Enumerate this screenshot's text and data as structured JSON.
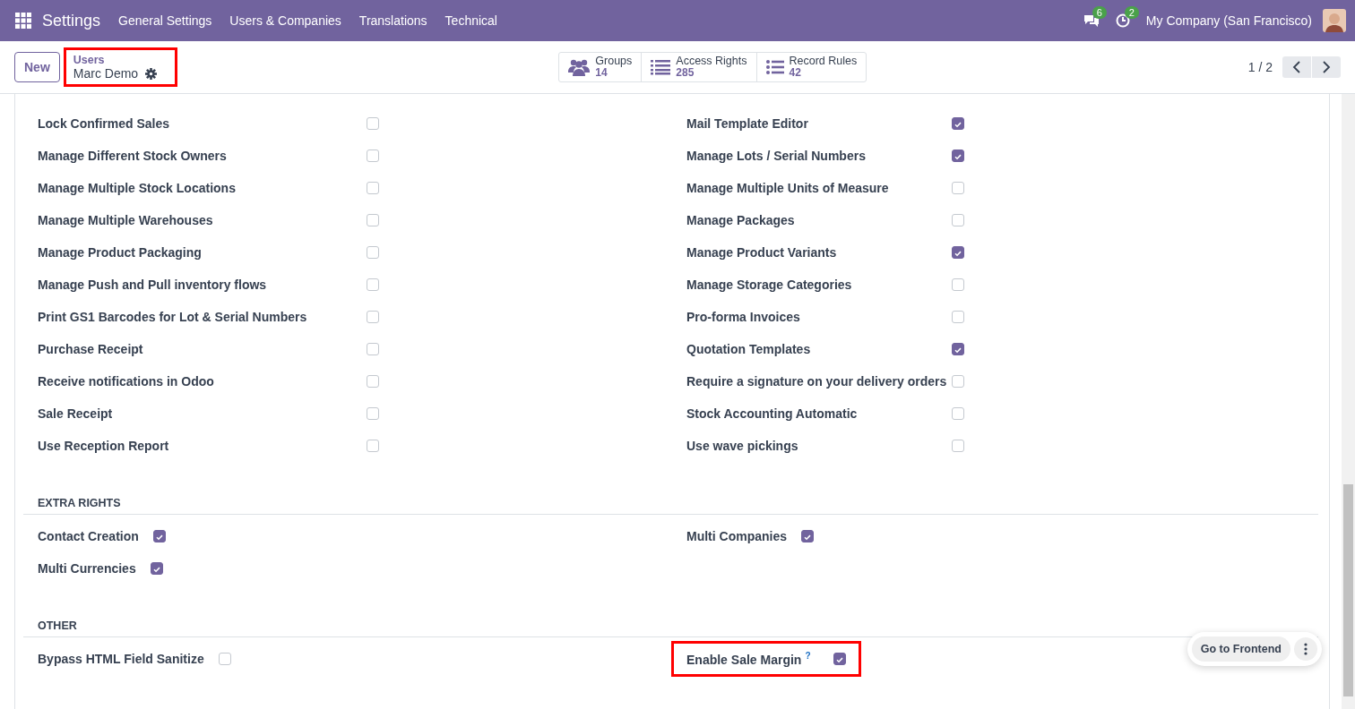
{
  "navbar": {
    "app": "Settings",
    "menus": [
      "General Settings",
      "Users & Companies",
      "Translations",
      "Technical"
    ],
    "messages_count": "6",
    "activities_count": "2",
    "company": "My Company (San Francisco)"
  },
  "control_panel": {
    "new_button": "New",
    "breadcrumb": {
      "parent": "Users",
      "current": "Marc Demo",
      "highlighted": true
    },
    "stat_buttons": [
      {
        "kind": "groups",
        "label": "Groups",
        "value": "14"
      },
      {
        "kind": "list",
        "label": "Access Rights",
        "value": "285"
      },
      {
        "kind": "rules",
        "label": "Record Rules",
        "value": "42"
      }
    ],
    "pager": "1 / 2"
  },
  "sections": [
    {
      "kind": "table",
      "items": [
        {
          "label": "Lock Confirmed Sales",
          "checked": false
        },
        {
          "label": "Mail Template Editor",
          "checked": true
        },
        {
          "label": "Manage Different Stock Owners",
          "checked": false
        },
        {
          "label": "Manage Lots / Serial Numbers",
          "checked": true
        },
        {
          "label": "Manage Multiple Stock Locations",
          "checked": false
        },
        {
          "label": "Manage Multiple Units of Measure",
          "checked": false
        },
        {
          "label": "Manage Multiple Warehouses",
          "checked": false
        },
        {
          "label": "Manage Packages",
          "checked": false
        },
        {
          "label": "Manage Product Packaging",
          "checked": false
        },
        {
          "label": "Manage Product Variants",
          "checked": true
        },
        {
          "label": "Manage Push and Pull inventory flows",
          "checked": false
        },
        {
          "label": "Manage Storage Categories",
          "checked": false
        },
        {
          "label": "Print GS1 Barcodes for Lot & Serial Numbers",
          "checked": false
        },
        {
          "label": "Pro-forma Invoices",
          "checked": false
        },
        {
          "label": "Purchase Receipt",
          "checked": false
        },
        {
          "label": "Quotation Templates",
          "checked": true
        },
        {
          "label": "Receive notifications in Odoo",
          "checked": false
        },
        {
          "label": "Require a signature on your delivery orders",
          "checked": false
        },
        {
          "label": "Sale Receipt",
          "checked": false
        },
        {
          "label": "Stock Accounting Automatic",
          "checked": false
        },
        {
          "label": "Use Reception Report",
          "checked": false
        },
        {
          "label": "Use wave pickings",
          "checked": false
        }
      ]
    },
    {
      "kind": "inline",
      "title": "EXTRA RIGHTS",
      "items": [
        {
          "label": "Contact Creation",
          "checked": true
        },
        {
          "label": "Multi Companies",
          "checked": true
        },
        {
          "label": "Multi Currencies",
          "checked": true
        }
      ]
    },
    {
      "kind": "inline",
      "title": "OTHER",
      "items": [
        {
          "label": "Bypass HTML Field Sanitize",
          "checked": false
        },
        {
          "label": "Enable Sale Margin",
          "help": "?",
          "checked": true,
          "highlighted": true
        }
      ]
    }
  ],
  "floating": {
    "button": "Go to Frontend"
  }
}
